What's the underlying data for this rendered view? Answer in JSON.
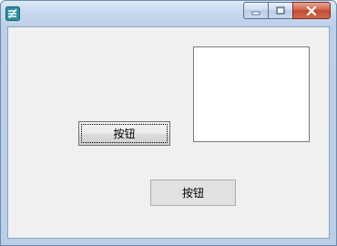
{
  "window": {
    "icon": "app-icon",
    "caption_buttons": [
      "minimize-icon",
      "maximize-icon",
      "close-icon"
    ],
    "close_color": "#c75050"
  },
  "content": {
    "button_1_label": "按钮",
    "button_2_label": "按钮"
  }
}
